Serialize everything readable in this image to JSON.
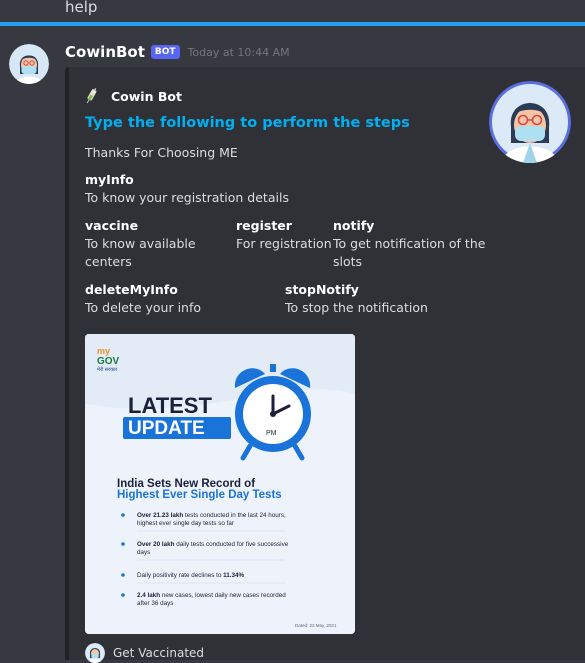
{
  "previous_message": {
    "text": "help"
  },
  "message": {
    "username": "CowinBot",
    "bot_tag": "BOT",
    "timestamp": "Today at 10:44 AM"
  },
  "embed": {
    "author": "Cowin Bot",
    "title": "Type the following to perform the steps",
    "description": "Thanks For Choosing ME",
    "fields": [
      {
        "name": "myInfo",
        "value": "To know your registration details"
      },
      {
        "name": "vaccine",
        "value": "To know available centers"
      },
      {
        "name": "register",
        "value": "For registration"
      },
      {
        "name": "notify",
        "value": "To get notification of the slots"
      },
      {
        "name": "deleteMyInfo",
        "value": "To delete your info"
      },
      {
        "name": "stopNotify",
        "value": "To stop the notification"
      }
    ],
    "image": {
      "brand_top": "my",
      "brand_main": "GOV",
      "brand_sub": "मेरी सरकार",
      "latest": "LATEST",
      "update": "UPDATE",
      "clock_label": "PM",
      "headline_1": "India Sets New Record of",
      "headline_2": "Highest Ever Single Day Tests",
      "bullets": [
        {
          "bold": "Over 21.23 lakh",
          "rest": " tests conducted in the last 24 hours,",
          "line2": "highest ever single day tests so far"
        },
        {
          "bold": "Over 20 lakh",
          "rest": " daily tests conducted for five successive",
          "line2": "days"
        },
        {
          "bold": "",
          "rest": "Daily positivity rate declines to ",
          "bold_end": "11.34%",
          "line2": ""
        },
        {
          "bold": "2.4 lakh",
          "rest": " new cases, lowest daily new cases recorded",
          "line2": "after 36 days"
        }
      ],
      "dated": "Dated: 23 May, 2021"
    },
    "footer": "Get Vaccinated"
  },
  "colors": {
    "background": "#36393f",
    "embed_background": "#2f3136",
    "title": "#00b0f4",
    "divider": "#1ea1f2",
    "bot_tag": "#5865f2",
    "poster_blue": "#1a73d9"
  }
}
